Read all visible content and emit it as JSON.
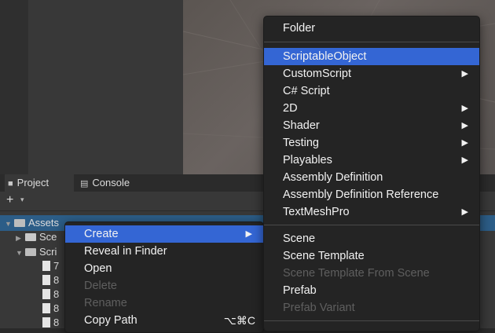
{
  "tabs": [
    {
      "label": "Project",
      "icon": "folder-icon"
    },
    {
      "label": "Console",
      "icon": "console-icon"
    }
  ],
  "toolbar": {
    "add_label": "+",
    "add_caret": "▾"
  },
  "tree": {
    "assets": "Assets",
    "scenes": "Sce",
    "scripts": "Scri",
    "files": [
      "7",
      "8",
      "8",
      "8",
      "8"
    ]
  },
  "context_menu": {
    "items": [
      {
        "label": "Create",
        "state": "highlighted",
        "submenu": true
      },
      {
        "label": "Reveal in Finder",
        "state": "enabled"
      },
      {
        "label": "Open",
        "state": "enabled"
      },
      {
        "label": "Delete",
        "state": "disabled"
      },
      {
        "label": "Rename",
        "state": "disabled"
      },
      {
        "label": "Copy Path",
        "state": "enabled",
        "shortcut": "⌥⌘C"
      }
    ]
  },
  "create_submenu": {
    "items": [
      {
        "label": "Folder"
      },
      {
        "label": "ScriptableObject",
        "state": "highlighted"
      },
      {
        "label": "CustomScript",
        "submenu": true
      },
      {
        "label": "C# Script"
      },
      {
        "label": "2D",
        "submenu": true
      },
      {
        "label": "Shader",
        "submenu": true
      },
      {
        "label": "Testing",
        "submenu": true
      },
      {
        "label": "Playables",
        "submenu": true
      },
      {
        "label": "Assembly Definition"
      },
      {
        "label": "Assembly Definition Reference"
      },
      {
        "label": "TextMeshPro",
        "submenu": true
      },
      {
        "label": "Scene"
      },
      {
        "label": "Scene Template"
      },
      {
        "label": "Scene Template From Scene",
        "state": "disabled"
      },
      {
        "label": "Prefab"
      },
      {
        "label": "Prefab Variant",
        "state": "disabled"
      }
    ]
  },
  "colors": {
    "highlight": "#3466d4",
    "selection": "#2c5d87",
    "menu_bg": "#242424"
  }
}
